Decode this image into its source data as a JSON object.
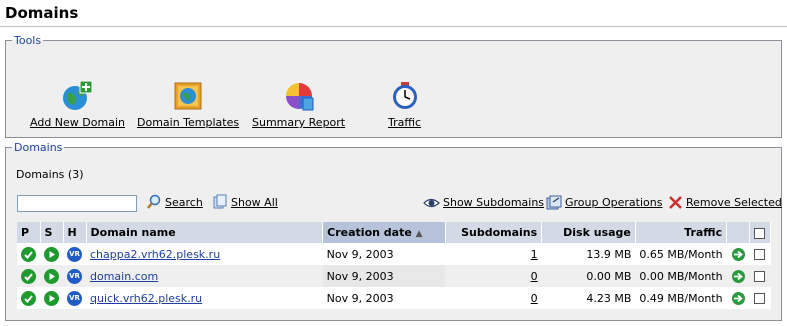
{
  "page": {
    "title": "Domains"
  },
  "tools": {
    "legend": "Tools",
    "items": [
      {
        "label": "Add New Domain"
      },
      {
        "label": "Domain Templates"
      },
      {
        "label": "Summary Report"
      },
      {
        "label": "Traffic"
      }
    ]
  },
  "domains": {
    "legend": "Domains",
    "count_label": "Domains (3)",
    "search": {
      "value": "",
      "button": "Search",
      "show_all": "Show All"
    },
    "actions": {
      "show_subdomains": "Show Subdomains",
      "group_operations": "Group Operations",
      "remove_selected": "Remove Selected"
    },
    "columns": {
      "p": "P",
      "s": "S",
      "h": "H",
      "name": "Domain name",
      "created": "Creation date",
      "subdomains": "Subdomains",
      "disk": "Disk usage",
      "traffic": "Traffic"
    },
    "rows": [
      {
        "name": "chappa2.vrh62.plesk.ru",
        "created": "Nov 9, 2003",
        "subdomains": "1",
        "disk": "13.9 MB",
        "traffic": "0.65 MB/Month"
      },
      {
        "name": "domain.com",
        "created": "Nov 9, 2003",
        "subdomains": "0",
        "disk": "0.00 MB",
        "traffic": "0.00 MB/Month"
      },
      {
        "name": "quick.vrh62.plesk.ru",
        "created": "Nov 9, 2003",
        "subdomains": "0",
        "disk": "4.23 MB",
        "traffic": "0.49 MB/Month"
      }
    ]
  },
  "icons": {
    "hosting_badge": "VR"
  }
}
